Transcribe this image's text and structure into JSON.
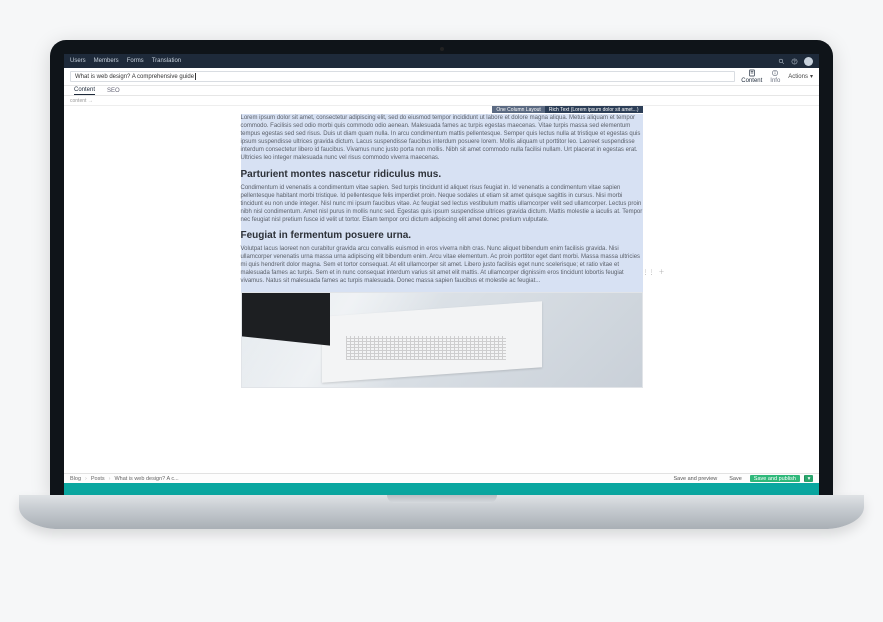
{
  "nav": {
    "items": [
      "Users",
      "Members",
      "Forms",
      "Translation"
    ]
  },
  "title_input": "What is web design? A comprehensive guide",
  "doc_tabs": {
    "content": "Content",
    "info": "Info"
  },
  "actions_label": "Actions",
  "subtabs": {
    "content": "Content",
    "seo": "SEO"
  },
  "side_caret_label": "content",
  "block_tag": {
    "layout": "One Column Layout",
    "type": "Rich Text (Lorem ipsum dolor sit amet...)"
  },
  "paras": {
    "p1": "Lorem ipsum dolor sit amet, consectetur adipiscing elit, sed do eiusmod tempor incididunt ut labore et dolore magna aliqua. Metus aliquam et tempor commodo. Facilisis sed odio morbi quis commodo odio aenean. Malesuada fames ac turpis egestas maecenas. Vitae turpis massa sed elementum tempus egestas sed sed risus. Duis ut diam quam nulla. In arcu condimentum mattis pellentesque. Semper quis lectus nulla at tristique et egestas quis ipsum suspendisse ultrices gravida dictum. Lacus suspendisse faucibus interdum posuere lorem. Mollis aliquam ut porttitor leo. Laoreet suspendisse interdum consectetur libero id faucibus. Vivamus nunc justo porta non mollis. Nibh sit amet commodo nulla facilisi nullam. Urt placerat in egestas erat. Ultricies leo integer malesuada nunc vel risus commodo viverra maecenas.",
    "h2a": "Parturient montes nascetur ridiculus mus.",
    "p2": "Condimentum id venenatis a condimentum vitae sapien. Sed turpis tincidunt id aliquet risus feugiat in. Id venenatis a condimentum vitae sapien pellentesque habitant morbi tristique. Id pellentesque felis imperdiet proin. Neque sodales ut etiam sit amet quisque sagittis in cursus. Nisi morbi tincidunt eu non unde integer. Nisl nunc mi ipsum faucibus vitae. Ac feugiat sed lectus vestibulum mattis ullamcorper velit sed ullamcorper. Lectus proin nibh nisl condimentum. Amet nisl purus in mollis nunc sed. Egestas quis ipsum suspendisse ultrices gravida dictum. Mattis molestie a iaculis at. Tempor nec feugiat nisl pretium fusce id velit ut tortor. Etiam tempor orci dictum adipiscing elit amet donec pretium vulputate.",
    "h2b": "Feugiat in fermentum posuere urna.",
    "p3": "Volutpat lacus laoreet non curabitur gravida arcu convallis euismod in eros viverra nibh cras. Nunc aliquet bibendum enim facilisis gravida. Nisi ullamcorper venenatis urna massa urna adipiscing elit bibendum enim. Arcu vitae elementum. Ac proin porttitor eget dant morbi. Massa massa ultricies mi quis hendrerit dolor magna. Sem et tortor consequat. At elit ullamcorper sit amet. Libero justo facilisis eget nunc scelerisque; et ratio vitae et malesuada fames ac turpis. Sem et in nunc consequat interdum varius sit amet elit mattis. At ullamcorper dignissim eros tincidunt lobortis feugiat vivamus. Natus sit malesuada fames ac turpis malesuada. Donec massa sapien faucibus et molestie ac feugiat..."
  },
  "breadcrumbs": [
    "Blog",
    "Posts",
    "What is web design? A c..."
  ],
  "footer_buttons": {
    "save_preview": "Save and preview",
    "save": "Save",
    "save_publish": "Save and publish"
  }
}
